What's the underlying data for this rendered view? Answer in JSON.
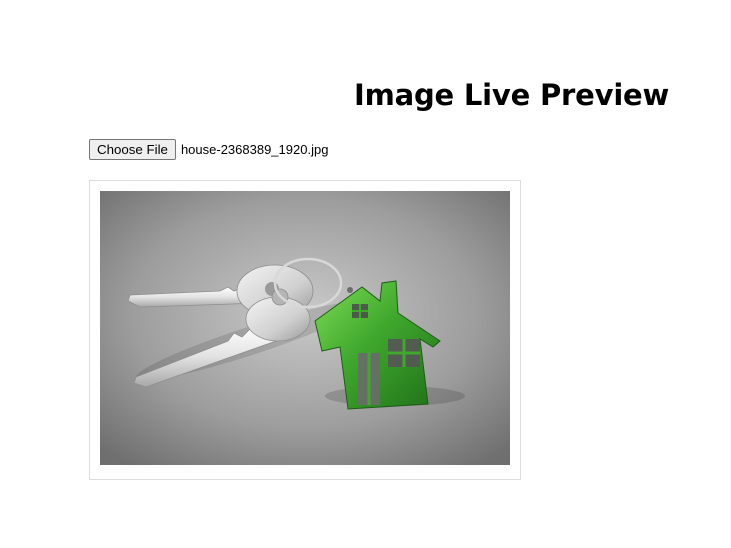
{
  "page": {
    "title": "Image Live Preview"
  },
  "file_input": {
    "button_label": "Choose File",
    "selected_file": "house-2368389_1920.jpg"
  },
  "preview": {
    "icon": "image-preview",
    "accent_color": "#3fa82d"
  }
}
